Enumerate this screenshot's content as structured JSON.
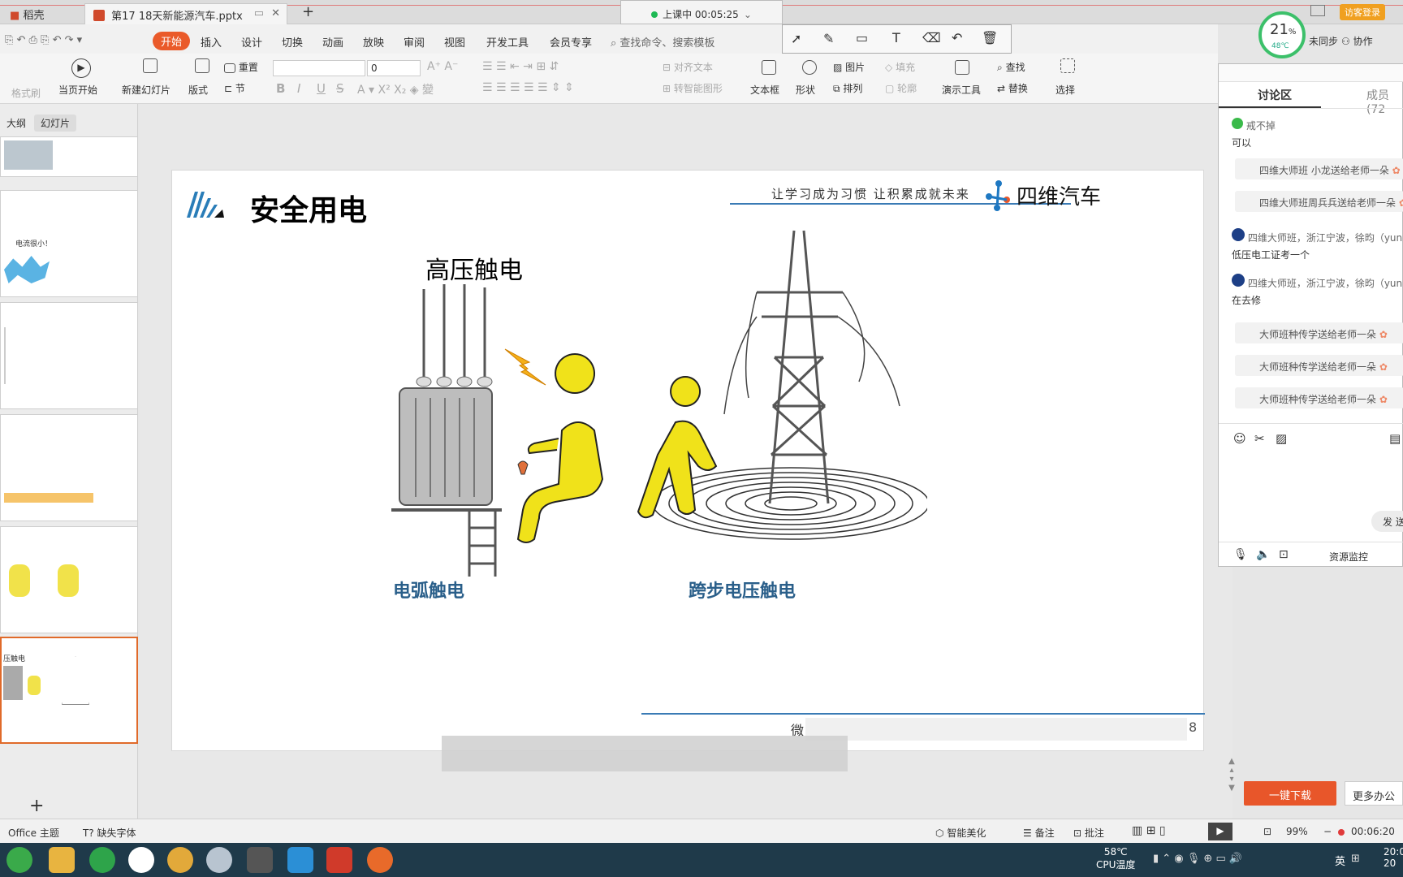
{
  "tabs": {
    "home": "稻壳",
    "document": "第17 18天新能源汽车.pptx",
    "new_tab": "+"
  },
  "recording": {
    "status": "上课中 00:05:25"
  },
  "top_right": {
    "login": "访客登录",
    "sync": "未同步",
    "collab": "协作"
  },
  "cpu_badge": {
    "percent": "21",
    "unit": "%",
    "temp": "48℃"
  },
  "menu": [
    "开始",
    "插入",
    "设计",
    "切换",
    "动画",
    "放映",
    "审阅",
    "视图",
    "开发工具",
    "会员专享"
  ],
  "menu_active": "开始",
  "search_placeholder": "查找命令、搜索模板",
  "ribbon": {
    "format_brush": "格式刷",
    "from_current": "当页开始",
    "new_slide": "新建幻灯片",
    "layout": "版式",
    "reset": "重置",
    "section": "节",
    "font_size": "0",
    "bold": "B",
    "italic": "I",
    "underline": "U",
    "strike": "S",
    "align_text": "对齐文本",
    "convert_smartart": "转智能图形",
    "textbox": "文本框",
    "shapes": "形状",
    "picture": "图片",
    "arrange": "排列",
    "fill": "填充",
    "outline": "轮廓",
    "present_tools": "演示工具",
    "find": "查找",
    "replace": "替换",
    "select": "选择"
  },
  "left_panel": {
    "outline_tab": "大纲",
    "slides_tab": "幻灯片",
    "add": "+"
  },
  "thumbs": {
    "t2_caption": "电流很小！",
    "t5_caption": "压触电"
  },
  "slide": {
    "title": "安全用电",
    "slogan": "让学习成为习惯   让积累成就未来",
    "brand": "四维汽车",
    "subtitle": "高压触电",
    "caption_left": "电弧触电",
    "caption_right": "跨步电压触电",
    "footer_left": "微",
    "footer_right": "8"
  },
  "right_panel": {
    "tab_discuss": "讨论区",
    "tab_members": "成员(72",
    "messages": [
      {
        "type": "user",
        "name": "戒不掉",
        "text": "可以"
      },
      {
        "type": "gift",
        "text": "四维大师班 小龙送给老师一朵"
      },
      {
        "type": "gift",
        "text": "四维大师班周兵兵送给老师一朵"
      },
      {
        "type": "user",
        "name": "四维大师班，浙江宁波，徐昀（yun",
        "text": "低压电工证考一个"
      },
      {
        "type": "user",
        "name": "四维大师班，浙江宁波，徐昀（yun",
        "text": "在去修"
      },
      {
        "type": "gift",
        "text": "大师班种传学送给老师一朵"
      },
      {
        "type": "gift",
        "text": "大师班种传学送给老师一朵"
      },
      {
        "type": "gift",
        "text": "大师班种传学送给老师一朵"
      }
    ],
    "send": "发 送",
    "resource_monitor": "资源监控"
  },
  "promo": {
    "download": "一键下载",
    "more": "更多办公"
  },
  "statusbar": {
    "theme": "Office 主题",
    "missing_font": "缺失字体",
    "beautify": "智能美化",
    "notes": "备注",
    "comments": "批注",
    "zoom": "99%",
    "timer": "00:06:20"
  },
  "taskbar": {
    "temp": "58℃",
    "temp_label": "CPU温度",
    "ime": "英",
    "time": "20:0",
    "date": "20"
  }
}
